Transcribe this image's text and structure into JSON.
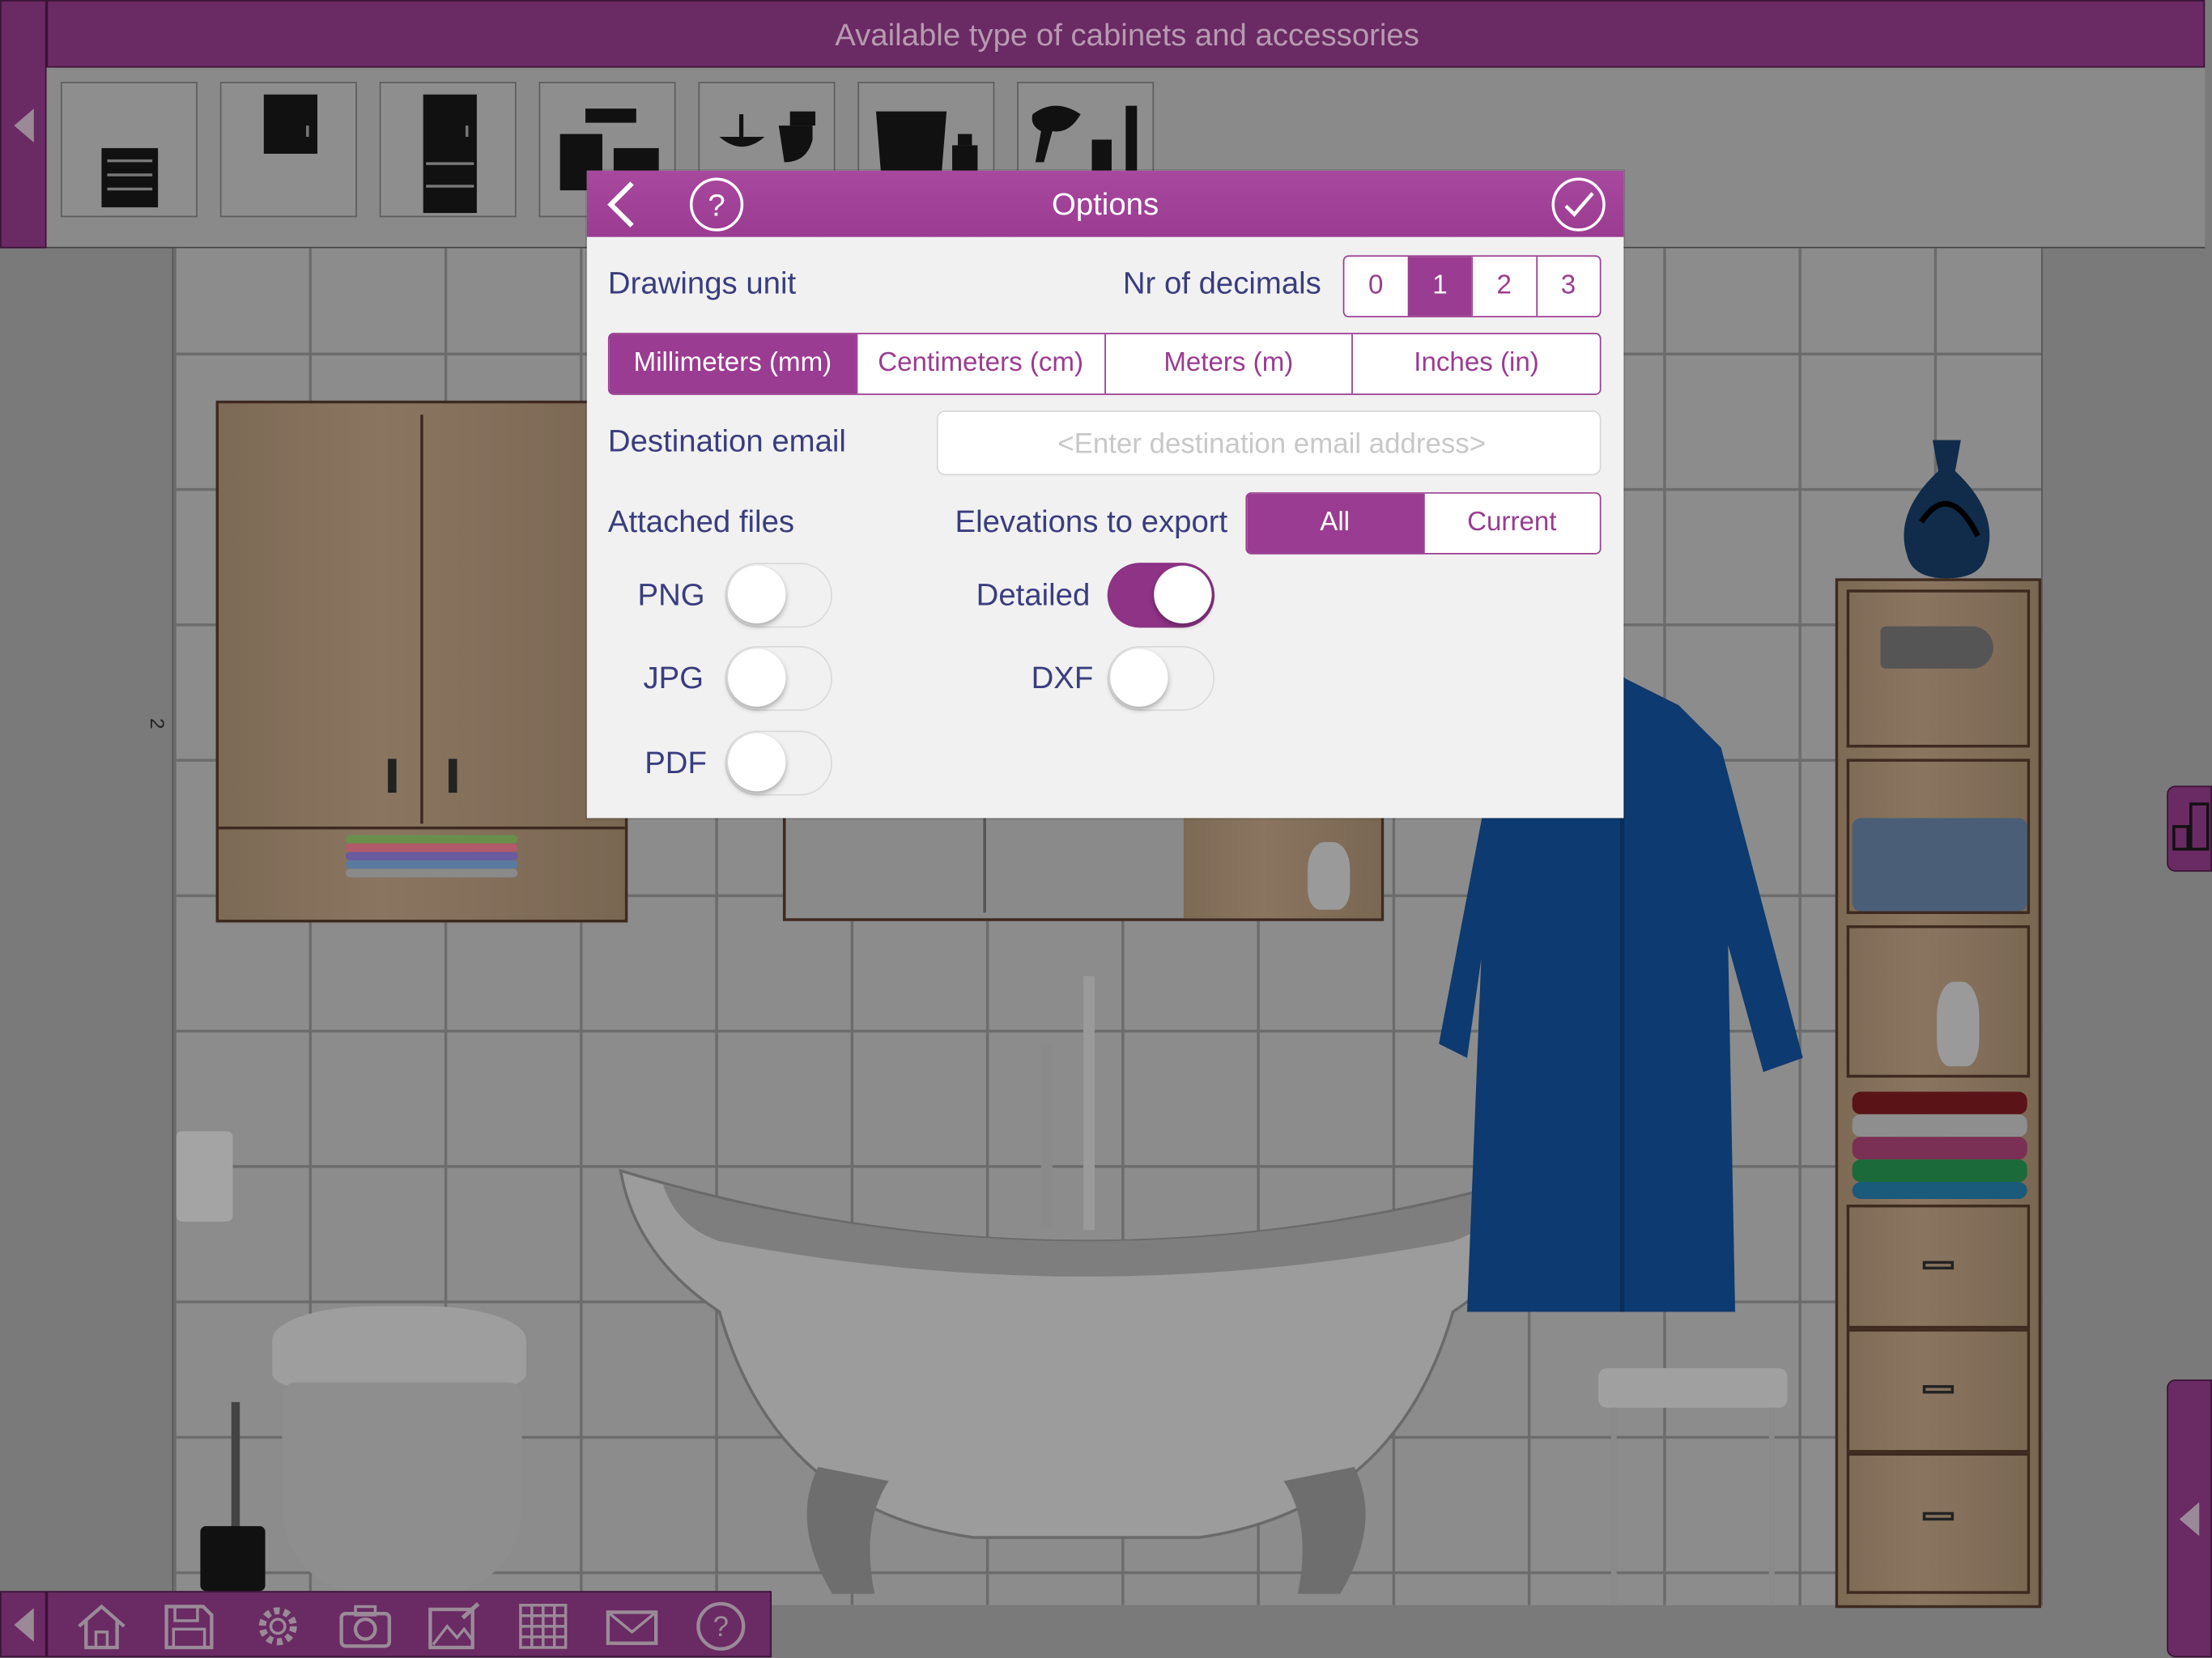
{
  "topbar": {
    "title": "Available type of cabinets and accessories"
  },
  "palette": {
    "items": [
      "drawer-cabinet-icon",
      "wall-cabinet-icon",
      "tall-cabinet-icon",
      "cabinet-set-icon",
      "sink-toilet-icon",
      "bathtub-accessories-icon",
      "hairdryer-accessories-icon"
    ]
  },
  "canvas": {
    "dimension_marker": "2"
  },
  "toolbar": {
    "items": [
      "home-icon",
      "save-icon",
      "gear-icon",
      "camera-icon",
      "edit-image-icon",
      "grid-icon",
      "mail-icon",
      "help-icon"
    ]
  },
  "dialog": {
    "title": "Options",
    "drawings_unit_label": "Drawings unit",
    "decimals_label": "Nr of decimals",
    "decimals": [
      "0",
      "1",
      "2",
      "3"
    ],
    "decimals_selected": "1",
    "units": [
      "Millimeters (mm)",
      "Centimeters (cm)",
      "Meters (m)",
      "Inches (in)"
    ],
    "unit_selected": "Millimeters (mm)",
    "email_label": "Destination email",
    "email_placeholder": "<Enter destination email address>",
    "email_value": "",
    "attached_label": "Attached files",
    "elevations_label": "Elevations to export",
    "elevations": [
      "All",
      "Current"
    ],
    "elevation_selected": "All",
    "png_label": "PNG",
    "png_on": false,
    "jpg_label": "JPG",
    "jpg_on": false,
    "pdf_label": "PDF",
    "pdf_on": false,
    "detailed_label": "Detailed",
    "detailed_on": true,
    "dxf_label": "DXF",
    "dxf_on": false
  },
  "colors": {
    "accent": "#9a3c91",
    "bar": "#6a2a63",
    "label": "#3a3d7e"
  }
}
